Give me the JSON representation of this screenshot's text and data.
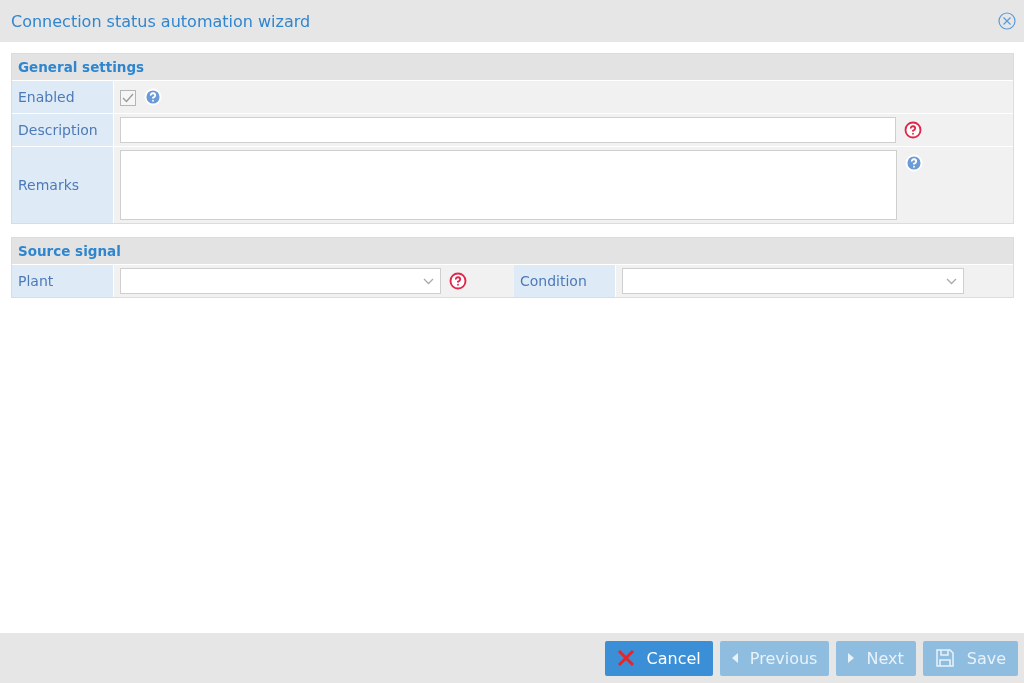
{
  "window": {
    "title": "Connection status automation wizard"
  },
  "sections": [
    {
      "title": "General settings",
      "rows": [
        {
          "fields": [
            {
              "label": "Enabled",
              "kind": "checkbox",
              "checked": true,
              "disabled": true,
              "info": true
            }
          ]
        },
        {
          "fields": [
            {
              "label": "Description",
              "kind": "text",
              "required": true
            }
          ]
        },
        {
          "fields": [
            {
              "label": "Remarks",
              "kind": "textarea",
              "info": true
            }
          ]
        }
      ]
    },
    {
      "title": "Source signal",
      "rows": [
        {
          "fields": [
            {
              "label": "Plant",
              "kind": "select",
              "required": true
            },
            {
              "label": "Condition",
              "kind": "select"
            }
          ]
        }
      ]
    }
  ],
  "buttons": [
    {
      "label": "Cancel",
      "kind": "cancel",
      "disabled": false
    },
    {
      "label": "Previous",
      "kind": "previous",
      "disabled": true
    },
    {
      "label": "Next",
      "kind": "next",
      "disabled": true
    },
    {
      "label": "Save",
      "kind": "save",
      "disabled": true
    }
  ]
}
